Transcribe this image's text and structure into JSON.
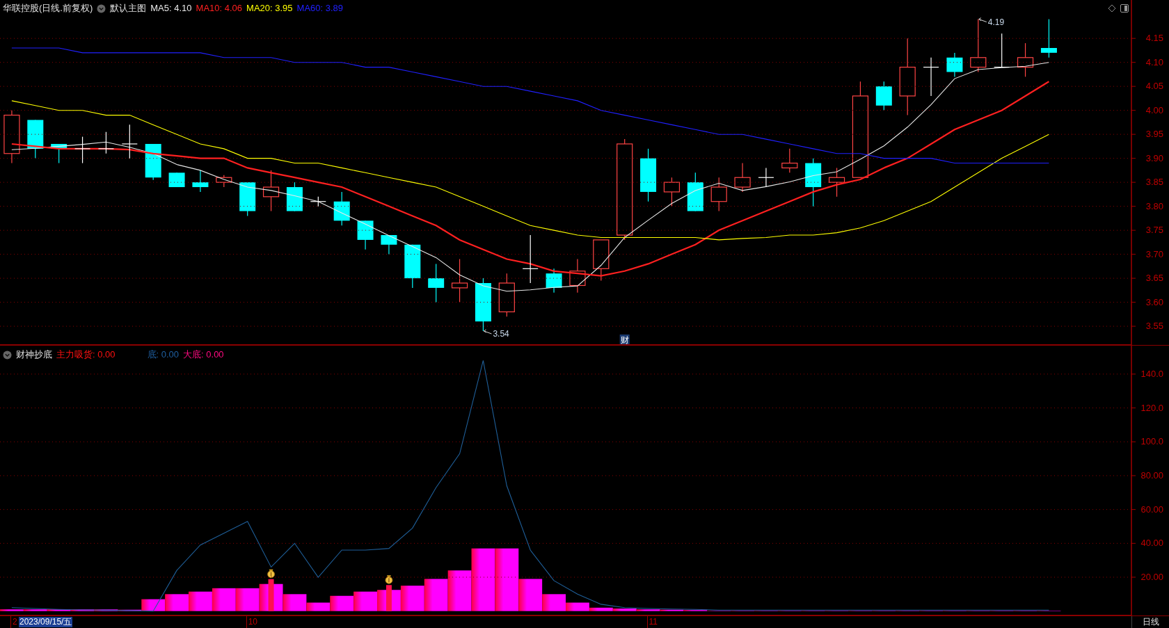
{
  "main_chart": {
    "header": {
      "title": "华联控股(日线.前复权)",
      "template": "默认主图",
      "legend": [
        {
          "label": "MA5: 4.10",
          "color": "#e8e8e8"
        },
        {
          "label": "MA10: 4.06",
          "color": "#ff2020"
        },
        {
          "label": "MA20: 3.95",
          "color": "#ffff00"
        },
        {
          "label": "MA60: 3.89",
          "color": "#2020ff"
        }
      ]
    },
    "chart_data": {
      "type": "line",
      "grid": true,
      "ylim": [
        3.511,
        4.23
      ],
      "yticks": [
        {
          "value": 4.15,
          "label": "4.15"
        },
        {
          "value": 4.1,
          "label": "4.10"
        },
        {
          "value": 4.05,
          "label": "4.05"
        },
        {
          "value": 4.0,
          "label": "4.00"
        },
        {
          "value": 3.95,
          "label": "3.95"
        },
        {
          "value": 3.9,
          "label": "3.90"
        },
        {
          "value": 3.85,
          "label": "3.85"
        },
        {
          "value": 3.8,
          "label": "3.80"
        },
        {
          "value": 3.75,
          "label": "3.75"
        },
        {
          "value": 3.7,
          "label": "3.70"
        },
        {
          "value": 3.65,
          "label": "3.65"
        },
        {
          "value": 3.6,
          "label": "3.60"
        },
        {
          "value": 3.55,
          "label": "3.55"
        }
      ],
      "series": [
        {
          "color": "#e8e8e8",
          "values": [
            3.918,
            3.921,
            3.925,
            3.929,
            3.934,
            3.923,
            3.91,
            3.887,
            3.875,
            3.856,
            3.84,
            3.833,
            3.822,
            3.81,
            3.786,
            3.763,
            3.739,
            3.716,
            3.693,
            3.657,
            3.634,
            3.623,
            3.626,
            3.631,
            3.634,
            3.677,
            3.735,
            3.771,
            3.806,
            3.833,
            3.848,
            3.833,
            3.841,
            3.851,
            3.864,
            3.872,
            3.898,
            3.926,
            3.965,
            4.012,
            4.066,
            4.085,
            4.089,
            4.092,
            4.1,
            null,
            null,
            null
          ]
        },
        {
          "color": "#ff2020",
          "values": [
            3.93,
            3.925,
            3.92,
            3.92,
            3.92,
            3.918,
            3.91,
            3.905,
            3.9,
            3.9,
            3.88,
            3.87,
            3.86,
            3.85,
            3.84,
            3.82,
            3.8,
            3.78,
            3.76,
            3.73,
            3.71,
            3.69,
            3.68,
            3.665,
            3.66,
            3.655,
            3.665,
            3.68,
            3.7,
            3.72,
            3.75,
            3.77,
            3.79,
            3.81,
            3.83,
            3.845,
            3.856,
            3.88,
            3.9,
            3.93,
            3.96,
            3.98,
            4.0,
            4.03,
            4.06,
            null,
            null,
            null
          ]
        },
        {
          "color": "#ffff00",
          "values": [
            4.02,
            4.01,
            4.0,
            4.0,
            3.99,
            3.99,
            3.97,
            3.95,
            3.93,
            3.92,
            3.9,
            3.9,
            3.89,
            3.89,
            3.88,
            3.87,
            3.86,
            3.85,
            3.84,
            3.82,
            3.8,
            3.78,
            3.76,
            3.75,
            3.74,
            3.735,
            3.735,
            3.735,
            3.735,
            3.735,
            3.73,
            3.733,
            3.735,
            3.74,
            3.74,
            3.745,
            3.755,
            3.77,
            3.79,
            3.81,
            3.84,
            3.87,
            3.9,
            3.925,
            3.95,
            null,
            null,
            null
          ]
        },
        {
          "color": "#2020ff",
          "values": [
            4.13,
            4.13,
            4.13,
            4.12,
            4.12,
            4.12,
            4.12,
            4.12,
            4.12,
            4.11,
            4.11,
            4.11,
            4.1,
            4.1,
            4.1,
            4.09,
            4.09,
            4.08,
            4.07,
            4.06,
            4.05,
            4.05,
            4.04,
            4.03,
            4.02,
            4.0,
            3.99,
            3.98,
            3.97,
            3.96,
            3.95,
            3.95,
            3.94,
            3.93,
            3.92,
            3.91,
            3.91,
            3.9,
            3.9,
            3.9,
            3.89,
            3.89,
            3.89,
            3.89,
            3.89,
            null,
            null,
            null
          ]
        }
      ]
    },
    "candlesticks": [
      {
        "kind": "up",
        "date_tick": "2"
      },
      {
        "kind": "down"
      },
      {
        "kind": "down"
      },
      {
        "kind": "doji"
      },
      {
        "kind": "doji"
      },
      {
        "kind": "doji"
      },
      {
        "kind": "down"
      },
      {
        "kind": "down"
      },
      {
        "kind": "down"
      },
      {
        "kind": "up"
      },
      {
        "kind": "down",
        "date_tick": "10"
      },
      {
        "kind": "up"
      },
      {
        "kind": "down"
      },
      {
        "kind": "doji"
      },
      {
        "kind": "down"
      },
      {
        "kind": "down"
      },
      {
        "kind": "down"
      },
      {
        "kind": "down"
      },
      {
        "kind": "down"
      },
      {
        "kind": "up"
      },
      {
        "kind": "down",
        "label": "3.54"
      },
      {
        "kind": "up"
      },
      {
        "kind": "doji"
      },
      {
        "kind": "down"
      },
      {
        "kind": "up"
      },
      {
        "kind": "up"
      },
      {
        "kind": "up",
        "badge": "财"
      },
      {
        "kind": "down",
        "date_tick": "11"
      },
      {
        "kind": "up"
      },
      {
        "kind": "down"
      },
      {
        "kind": "up"
      },
      {
        "kind": "up"
      },
      {
        "kind": "doji"
      },
      {
        "kind": "up"
      },
      {
        "kind": "down"
      },
      {
        "kind": "up"
      },
      {
        "kind": "up"
      },
      {
        "kind": "down"
      },
      {
        "kind": "up"
      },
      {
        "kind": "doji"
      },
      {
        "kind": "down"
      },
      {
        "kind": "up",
        "label": "4.19"
      },
      {
        "kind": "doji"
      },
      {
        "kind": "up"
      },
      {
        "kind": "down"
      }
    ]
  },
  "indicator": {
    "header": {
      "title": "财神抄底",
      "legend": [
        {
          "label": "主力吸货: 0.00",
          "color": "#ff1010"
        },
        {
          "label": "底: 0.00",
          "color": "#1f5fa0"
        },
        {
          "label": "大底: 0.00",
          "color": "#ff0a80"
        }
      ]
    },
    "chart_data": {
      "type": "line",
      "grid": true,
      "ylim": [
        -2.603,
        156.8
      ],
      "yticks": [
        {
          "value": 140,
          "label": "140.0"
        },
        {
          "value": 120,
          "label": "120.0"
        },
        {
          "value": 100,
          "label": "100.0"
        },
        {
          "value": 80,
          "label": "80.00"
        },
        {
          "value": 60,
          "label": "60.00"
        },
        {
          "value": 40,
          "label": "40.00"
        },
        {
          "value": 20,
          "label": "20.00"
        }
      ],
      "series": [
        {
          "color": "#1f5f99",
          "values": [
            2,
            1.5,
            1,
            0.7,
            0.5,
            0.3,
            0,
            24,
            39,
            46,
            53,
            26,
            40,
            20,
            36,
            36,
            37,
            49,
            73,
            93,
            148,
            74,
            36,
            18,
            10,
            4,
            2,
            1.5,
            1.2,
            1,
            0.6,
            0.6,
            0.6,
            0.6,
            0.6,
            0.6,
            0.6,
            0.6,
            0.6,
            0.6,
            0.6,
            0.6,
            0.6,
            0.6,
            0.6,
            null,
            null,
            null
          ]
        }
      ]
    },
    "histogram": {
      "color": "#ff00ff",
      "bars": [
        {
          "money_bag": false
        },
        {
          "money_bag": false
        },
        {
          "money_bag": false
        },
        {
          "money_bag": false
        },
        {
          "money_bag": false
        },
        {
          "money_bag": false
        },
        {
          "money_bag": false
        },
        {
          "money_bag": false
        },
        {
          "money_bag": false
        },
        {
          "money_bag": false
        },
        {
          "money_bag": false
        },
        {
          "money_bag": true
        },
        {
          "money_bag": false
        },
        {
          "money_bag": false
        },
        {
          "money_bag": false
        },
        {
          "money_bag": false
        },
        {
          "money_bag": true
        },
        {
          "money_bag": false
        },
        {
          "money_bag": false
        },
        {
          "money_bag": false
        },
        {
          "money_bag": false
        },
        {
          "money_bag": false
        },
        {
          "money_bag": false
        },
        {
          "money_bag": false
        },
        {
          "money_bag": false
        },
        {
          "money_bag": false
        },
        {
          "money_bag": false
        },
        {
          "money_bag": false
        },
        {
          "money_bag": false
        },
        {
          "money_bag": false
        },
        {
          "money_bag": false
        },
        {
          "money_bag": false
        },
        {
          "money_bag": false
        },
        {
          "money_bag": false
        },
        {
          "money_bag": false
        },
        {
          "money_bag": false
        },
        {
          "money_bag": false
        },
        {
          "money_bag": false
        },
        {
          "money_bag": false
        },
        {
          "money_bag": false
        },
        {
          "money_bag": false
        },
        {
          "money_bag": false
        },
        {
          "money_bag": false
        },
        {
          "money_bag": false
        },
        {
          "money_bag": false
        }
      ]
    }
  },
  "date_axis": {
    "cursor_date": "2023/09/15/五",
    "period": "日线"
  }
}
